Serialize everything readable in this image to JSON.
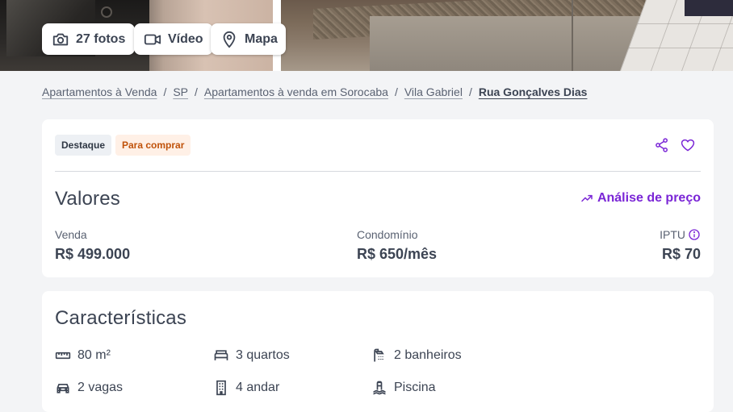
{
  "gallery": {
    "photos_label": "27 fotos",
    "video_label": "Vídeo",
    "map_label": "Mapa"
  },
  "breadcrumb": {
    "items": [
      "Apartamentos à Venda",
      "SP",
      "Apartamentos à venda em Sorocaba",
      "Vila Gabriel"
    ],
    "current": "Rua Gonçalves Dias"
  },
  "badges": {
    "highlight": "Destaque",
    "purpose": "Para comprar"
  },
  "values": {
    "title": "Valores",
    "analysis_link": "Análise de preço",
    "sale_label": "Venda",
    "sale_value": "R$ 499.000",
    "condo_label": "Condomínio",
    "condo_value": "R$ 650/mês",
    "iptu_label": "IPTU",
    "iptu_value": "R$ 70"
  },
  "features": {
    "title": "Características",
    "items": [
      {
        "icon": "ruler-icon",
        "label": "80 m²"
      },
      {
        "icon": "bed-icon",
        "label": "3 quartos"
      },
      {
        "icon": "shower-icon",
        "label": "2 banheiros"
      },
      {
        "icon": "car-icon",
        "label": "2 vagas"
      },
      {
        "icon": "building-icon",
        "label": "4 andar"
      },
      {
        "icon": "pool-icon",
        "label": "Piscina"
      }
    ]
  },
  "colors": {
    "accent": "#7a25d6",
    "text": "#3c4453",
    "background": "#f3f4f6",
    "purpose_badge_text": "#c0520a",
    "purpose_badge_bg": "#fff0e6"
  }
}
